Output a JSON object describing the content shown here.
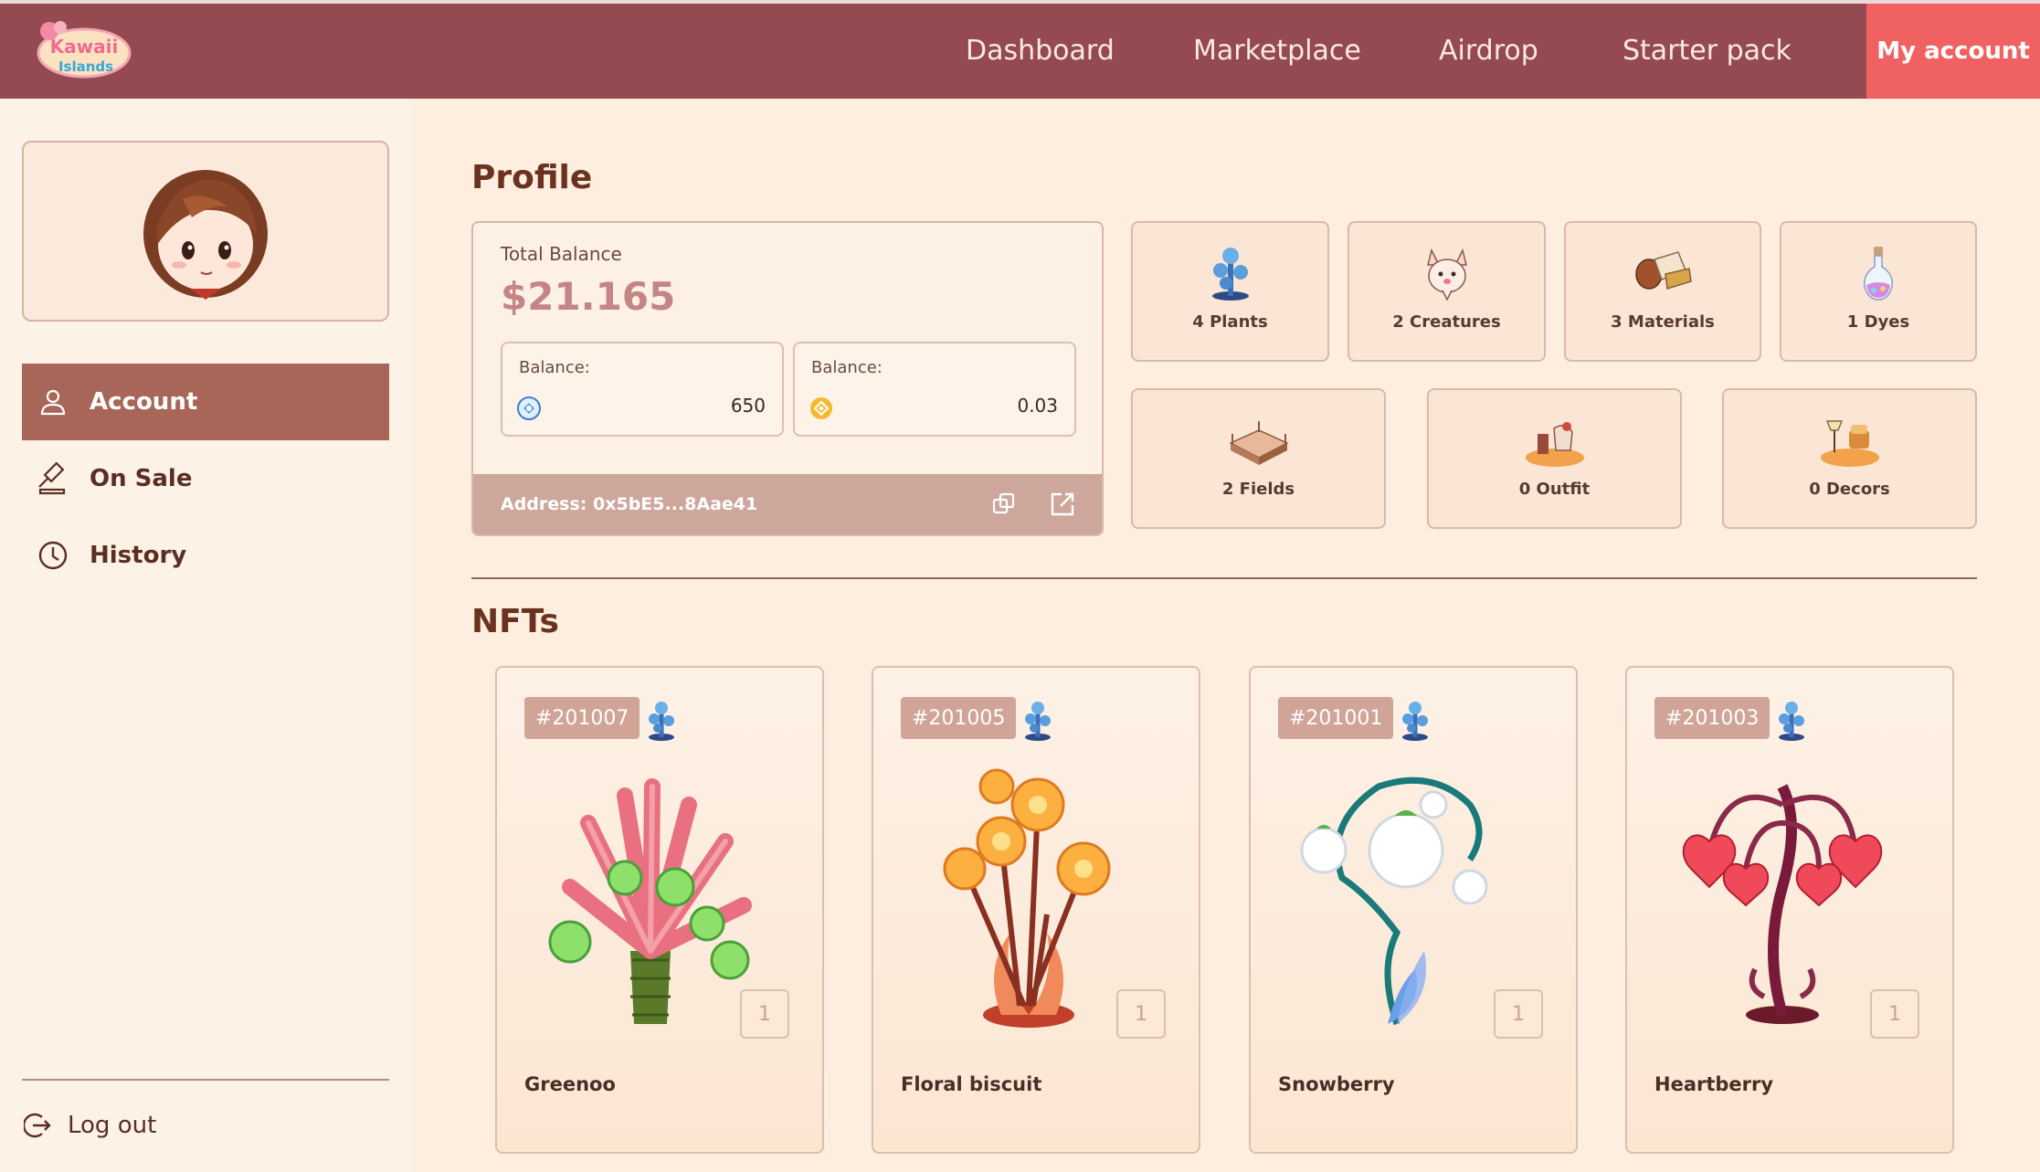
{
  "header": {
    "logo_text": "Kawaii Islands",
    "nav": [
      "Dashboard",
      "Marketplace",
      "Airdrop",
      "Starter pack"
    ],
    "account_button": "My account"
  },
  "sidebar": {
    "items": [
      {
        "label": "Account",
        "icon": "user-icon",
        "active": true
      },
      {
        "label": "On Sale",
        "icon": "gavel-icon",
        "active": false
      },
      {
        "label": "History",
        "icon": "clock-icon",
        "active": false
      }
    ],
    "logout": "Log out"
  },
  "profile": {
    "title": "Profile",
    "total_balance_label": "Total Balance",
    "total_balance_value": "$21.165",
    "balances": [
      {
        "label": "Balance:",
        "value": "650",
        "coin": "kwt-coin-icon"
      },
      {
        "label": "Balance:",
        "value": "0.03",
        "coin": "bnb-coin-icon"
      }
    ],
    "address": "Address: 0x5bE5...8Aae41",
    "categories": [
      {
        "label": "4 Plants",
        "icon": "plant-icon"
      },
      {
        "label": "2 Creatures",
        "icon": "creature-icon"
      },
      {
        "label": "3 Materials",
        "icon": "materials-icon"
      },
      {
        "label": "1 Dyes",
        "icon": "dye-potion-icon"
      },
      {
        "label": "2 Fields",
        "icon": "field-icon"
      },
      {
        "label": "0 Outfit",
        "icon": "outfit-icon"
      },
      {
        "label": "0 Decors",
        "icon": "decor-icon"
      }
    ]
  },
  "nfts": {
    "title": "NFTs",
    "items": [
      {
        "id": "#201007",
        "name": "Greenoo",
        "qty": "1"
      },
      {
        "id": "#201005",
        "name": "Floral biscuit",
        "qty": "1"
      },
      {
        "id": "#201001",
        "name": "Snowberry",
        "qty": "1"
      },
      {
        "id": "#201003",
        "name": "Heartberry",
        "qty": "1"
      }
    ]
  },
  "colors": {
    "header": "#944a50",
    "accent": "#f06262",
    "active_menu": "#a86658",
    "background": "#fdeedf"
  }
}
